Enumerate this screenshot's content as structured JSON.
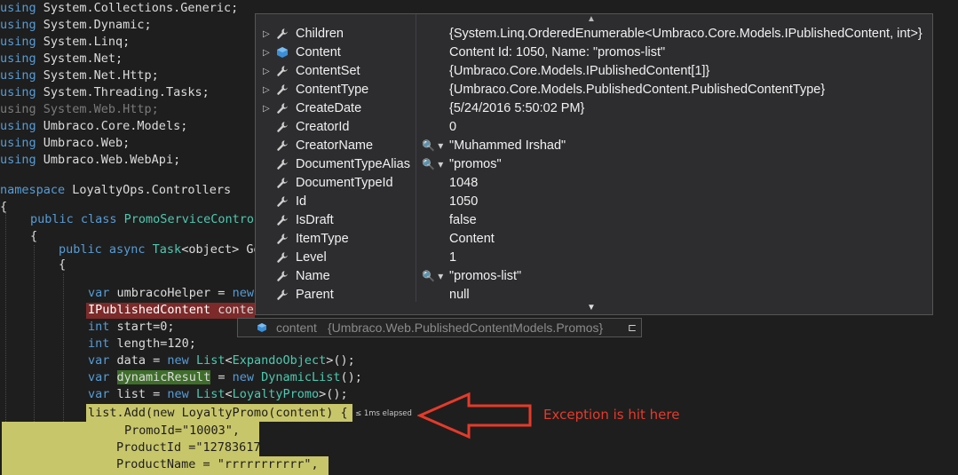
{
  "code_lines": {
    "l1": "using System.Collections.Generic;",
    "l2": "using System.Dynamic;",
    "l3": "using System.Linq;",
    "l4": "using System.Net;",
    "l5": "using System.Net.Http;",
    "l6": "using System.Threading.Tasks;",
    "l7": "using System.Web.Http;",
    "l8": "using Umbraco.Core.Models;",
    "l9": "using Umbraco.Web;",
    "l10": "using Umbraco.Web.WebApi;",
    "l11": "namespace LoyaltyOps.Controllers",
    "l12": "{",
    "l13a": "public class ",
    "l13b": "PromoServiceControl",
    "l14": "{",
    "l15a": "public async ",
    "l15b": "Task",
    "l15c": "<object> Ge",
    "l16": "{",
    "l17a": "var",
    "l17b": " umbracoHelper = ",
    "l17c": "new",
    "l18": "IPublishedContent conten",
    "l19a": "int",
    "l19b": " start=0;",
    "l20a": "int",
    "l20b": " length=120;",
    "l21a": "var",
    "l21b": " data = ",
    "l21c": "new",
    "l21d": " List",
    "l21e": "<",
    "l21f": "ExpandoObject",
    "l21g": ">();",
    "l22a": "var",
    "l22b": "dynamicResult",
    "l22c": " = ",
    "l22d": "new",
    "l22e": "DynamicList",
    "l22f": "();",
    "l23a": "var",
    "l23b": " list = ",
    "l23c": "new",
    "l23d": " List",
    "l23e": "<",
    "l23f": "LoyaltyPromo",
    "l23g": ">();",
    "l24": "list.Add(new LoyaltyPromo(content) {",
    "l25": "PromoId=\"10003\",",
    "l26": "ProductId =\"127836172\",",
    "l27": "ProductName = \"rrrrrrrrrrr\","
  },
  "elapsed": "≤ 1ms elapsed",
  "datatip": {
    "rows": [
      {
        "expand": true,
        "icon": "wrench-icon",
        "name": "Children",
        "magnifier": false,
        "value": "{System.Linq.OrderedEnumerable<Umbraco.Core.Models.IPublishedContent, int>}"
      },
      {
        "expand": true,
        "icon": "object-cube-icon",
        "name": "Content",
        "magnifier": false,
        "value": "Content Id: 1050, Name: \"promos-list\""
      },
      {
        "expand": true,
        "icon": "wrench-icon",
        "name": "ContentSet",
        "magnifier": false,
        "value": "{Umbraco.Core.Models.IPublishedContent[1]}"
      },
      {
        "expand": true,
        "icon": "wrench-icon",
        "name": "ContentType",
        "magnifier": false,
        "value": "{Umbraco.Core.Models.PublishedContent.PublishedContentType}"
      },
      {
        "expand": true,
        "icon": "wrench-icon",
        "name": "CreateDate",
        "magnifier": false,
        "value": "{5/24/2016 5:50:02 PM}"
      },
      {
        "expand": false,
        "icon": "wrench-icon",
        "name": "CreatorId",
        "magnifier": false,
        "value": "0"
      },
      {
        "expand": false,
        "icon": "wrench-icon",
        "name": "CreatorName",
        "magnifier": true,
        "value": "\"Muhammed Irshad\""
      },
      {
        "expand": false,
        "icon": "wrench-icon",
        "name": "DocumentTypeAlias",
        "magnifier": true,
        "value": "\"promos\""
      },
      {
        "expand": false,
        "icon": "wrench-icon",
        "name": "DocumentTypeId",
        "magnifier": false,
        "value": "1048"
      },
      {
        "expand": false,
        "icon": "wrench-icon",
        "name": "Id",
        "magnifier": false,
        "value": "1050"
      },
      {
        "expand": false,
        "icon": "wrench-icon",
        "name": "IsDraft",
        "magnifier": false,
        "value": "false"
      },
      {
        "expand": false,
        "icon": "wrench-icon",
        "name": "ItemType",
        "magnifier": false,
        "value": "Content"
      },
      {
        "expand": false,
        "icon": "wrench-icon",
        "name": "Level",
        "magnifier": false,
        "value": "1"
      },
      {
        "expand": false,
        "icon": "wrench-icon",
        "name": "Name",
        "magnifier": true,
        "value": "\"promos-list\""
      },
      {
        "expand": false,
        "icon": "wrench-icon",
        "name": "Parent",
        "magnifier": false,
        "value": "null"
      }
    ],
    "expand_glyph": "▷",
    "magnifier_glyph": "🔍 ▾",
    "scroll_up_glyph": "▲",
    "scroll_down_glyph": "▼"
  },
  "pinned": {
    "name": "content",
    "type": "{Umbraco.Web.PublishedContentModels.Promos}",
    "pin_glyph": "⊏"
  },
  "annotation": "Exception is hit here",
  "colors": {
    "background": "#1e1e1e",
    "keyword": "#569cd6",
    "type": "#4ec9b0",
    "string": "#d69d85",
    "error_line": "#7c2a2a",
    "current_statement": "#c8c66a",
    "annotation": "#e53a2a"
  }
}
